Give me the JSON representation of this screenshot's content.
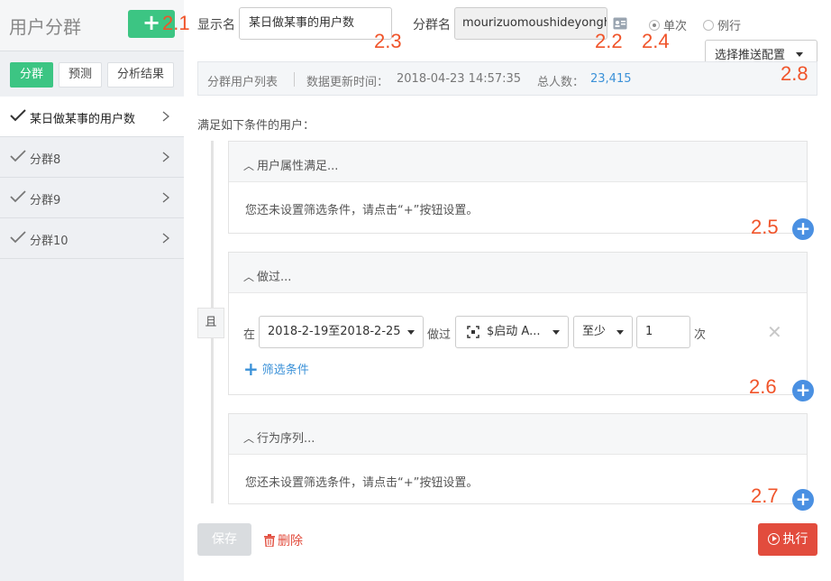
{
  "sidebar": {
    "title": "用户分群",
    "add_label": "+",
    "tabs": [
      {
        "label": "分群"
      },
      {
        "label": "预测"
      },
      {
        "label": "分析结果"
      }
    ],
    "items": [
      {
        "label": "某日做某事的用户数"
      },
      {
        "label": "分群8"
      },
      {
        "label": "分群9"
      },
      {
        "label": "分群10"
      }
    ]
  },
  "annotations": {
    "a21": "2.1",
    "a22": "2.2",
    "a23": "2.3",
    "a24": "2.4",
    "a25": "2.5",
    "a26": "2.6",
    "a27": "2.7",
    "a28": "2.8"
  },
  "form": {
    "display_name_label": "显示名",
    "display_name_value": "某日做某事的用户数",
    "group_name_label": "分群名",
    "group_name_value": "mourizuomoushideyongh",
    "radio_once": "单次",
    "radio_routine": "例行",
    "push_config_label": "选择推送配置"
  },
  "info_bar": {
    "list_label": "分群用户列表",
    "update_label": "数据更新时间：",
    "update_time": "2018-04-23 14:57:35",
    "total_label": "总人数：",
    "total_value": "23,415"
  },
  "conditions": {
    "title": "满足如下条件的用户：",
    "and_label": "且",
    "user_attr_title": "用户属性满足...",
    "empty_hint": "您还未设置筛选条件，请点击“+”按钮设置。",
    "did_title": "做过...",
    "in_label": "在",
    "date_range": "2018-2-19至2018-2-25",
    "did_label": "做过",
    "event": "$启动 A...",
    "at_least": "至少",
    "count": "1",
    "times_label": "次",
    "filter_label": "筛选条件",
    "sequence_title": "行为序列..."
  },
  "actions": {
    "save": "保存",
    "delete": "删除",
    "run": "执行"
  },
  "colors": {
    "green": "#3cc583",
    "blue": "#4a90e2",
    "red": "#e24c3d",
    "annotation": "#f0542a"
  }
}
